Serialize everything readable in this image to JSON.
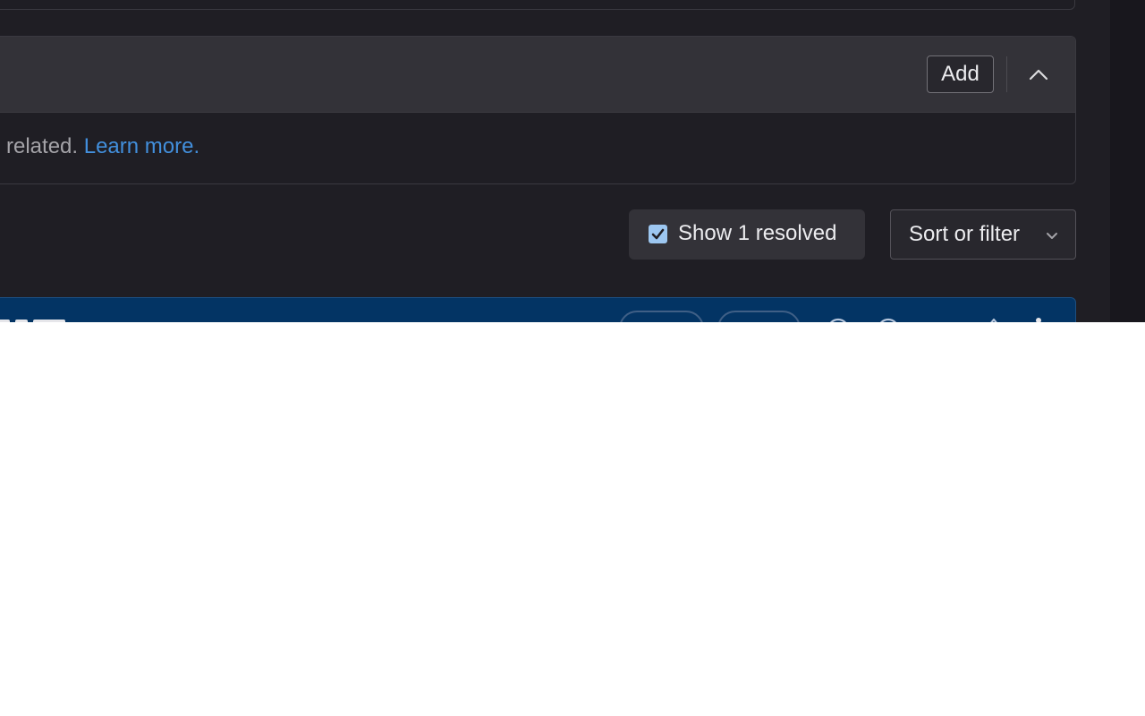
{
  "related_section": {
    "add_label": "Add",
    "collapse_icon": "chevron-up-icon",
    "help_text": "re related. ",
    "help_link": "Learn more."
  },
  "controls": {
    "show_resolved_label": "Show 1 resolved",
    "show_resolved_checked": true,
    "sort_label": "Sort or filter",
    "sort_icon": "chevron-down-icon"
  },
  "colors": {
    "page_bg": "#1f1e24",
    "header_bg": "#333238",
    "link": "#428fdc",
    "thread_bg": "#033464",
    "checkbox": "#9dc7f1"
  }
}
